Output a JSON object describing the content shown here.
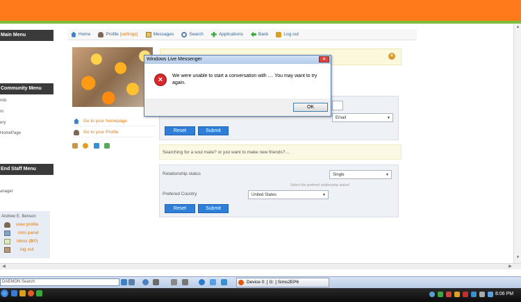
{
  "sidebar": {
    "main_menu": "Main Menu",
    "community_menu": "Community Menu",
    "community_items": [
      "nds",
      "m",
      "ery",
      "HomePage"
    ],
    "staff_menu": "End Staff Menu",
    "staff_items": [
      "anager"
    ],
    "user": {
      "name": "Andrew E. Benson",
      "view_profile": "view profile",
      "mini_panel": "mini panel",
      "inbox_prefix": "inbox (",
      "inbox_unread": "0",
      "inbox_sep": "/",
      "inbox_total": "0",
      "inbox_suffix": ")",
      "log_out": "log out"
    }
  },
  "nav": {
    "home": "Home",
    "profile": "Profile",
    "settings": "[settings]",
    "messages": "Messages",
    "search": "Search",
    "applications": "Applications",
    "back": "Back",
    "logout": "Log out"
  },
  "quick_links": {
    "homepage": "Go to your homepage",
    "profile": "Go to your Profile"
  },
  "form1": {
    "select_value": "Email",
    "reset": "Reset",
    "submit": "Submit"
  },
  "soul_mate_text": "Searching for a soul mate? or just want to make new friends?....",
  "form2": {
    "relationship_label": "Relationship status",
    "relationship_value": "Single",
    "relationship_hint": "Select the prefered relationship status!",
    "country_label": "Prefered Country",
    "country_value": "United States",
    "reset": "Reset",
    "submit": "Submit"
  },
  "dialog": {
    "title": "Windows Live Messenger",
    "message": "We were unable to start a conversation with .... You may want to try again.",
    "ok": "OK"
  },
  "taskbar": {
    "daemon_search": "DAEMON Search",
    "device_task": "Device 0: [ G: ] Sims2EP6",
    "time": "8:06 PM"
  },
  "colors": {
    "header_orange": "#ff7a1a",
    "header_green": "#7cbf3c",
    "button_blue": "#2f7fd8",
    "link_orange": "#e07a10",
    "menu_dark": "#3a3a3a"
  }
}
